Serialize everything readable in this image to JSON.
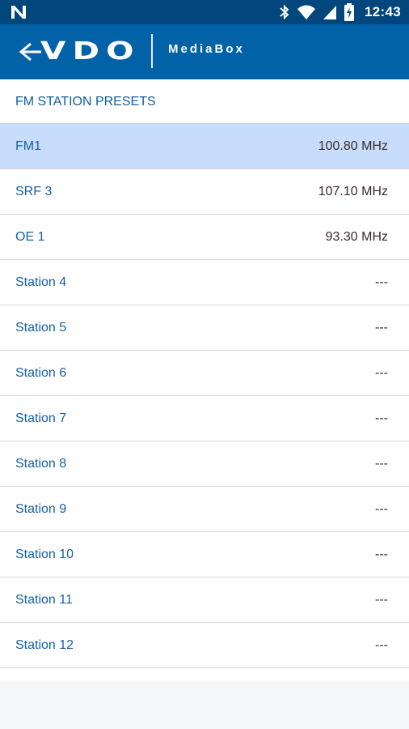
{
  "status_bar": {
    "time": "12:43",
    "icons": [
      "notification-n-icon",
      "bluetooth-icon",
      "wifi-icon",
      "cell-signal-icon",
      "battery-charging-icon"
    ]
  },
  "header": {
    "logo_text": "VDO",
    "app_name": "MediaBox",
    "colors": {
      "bar": "#0162a8",
      "status": "#01467c"
    }
  },
  "section": {
    "title": "FM STATION PRESETS"
  },
  "presets": [
    {
      "name": "FM1",
      "freq": "100.80 MHz",
      "selected": true
    },
    {
      "name": "SRF 3",
      "freq": "107.10 MHz",
      "selected": false
    },
    {
      "name": "OE 1",
      "freq": "93.30 MHz",
      "selected": false
    },
    {
      "name": "Station 4",
      "freq": "---",
      "selected": false
    },
    {
      "name": "Station 5",
      "freq": "---",
      "selected": false
    },
    {
      "name": "Station 6",
      "freq": "---",
      "selected": false
    },
    {
      "name": "Station 7",
      "freq": "---",
      "selected": false
    },
    {
      "name": "Station 8",
      "freq": "---",
      "selected": false
    },
    {
      "name": "Station 9",
      "freq": "---",
      "selected": false
    },
    {
      "name": "Station 10",
      "freq": "---",
      "selected": false
    },
    {
      "name": "Station 11",
      "freq": "---",
      "selected": false
    },
    {
      "name": "Station 12",
      "freq": "---",
      "selected": false
    }
  ]
}
